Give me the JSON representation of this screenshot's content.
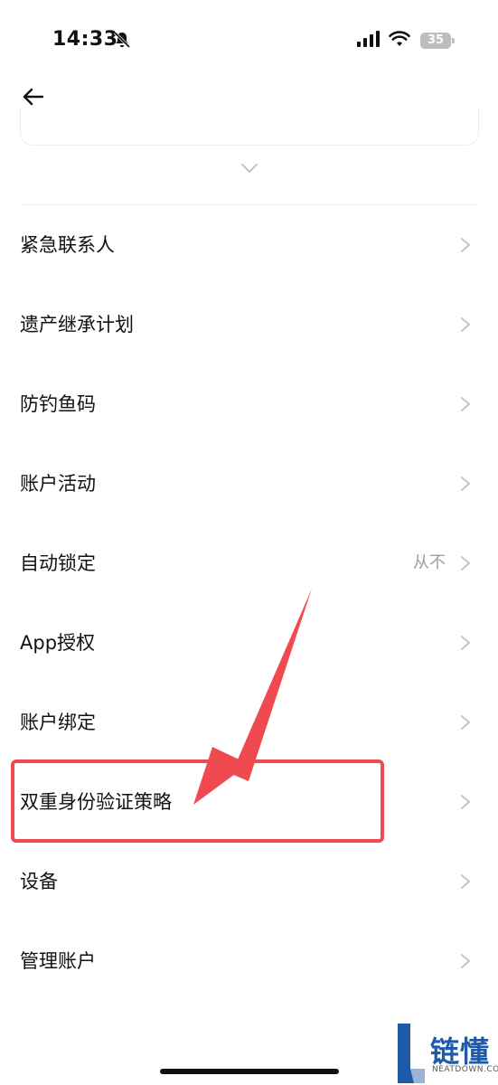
{
  "status_bar": {
    "time": "14:33",
    "battery": "35"
  },
  "menu_items": [
    {
      "label": "紧急联系人",
      "value": ""
    },
    {
      "label": "遗产继承计划",
      "value": ""
    },
    {
      "label": "防钓鱼码",
      "value": ""
    },
    {
      "label": "账户活动",
      "value": ""
    },
    {
      "label": "自动锁定",
      "value": "从不"
    },
    {
      "label": "App授权",
      "value": ""
    },
    {
      "label": "账户绑定",
      "value": ""
    },
    {
      "label": "双重身份验证策略",
      "value": ""
    },
    {
      "label": "设备",
      "value": ""
    },
    {
      "label": "管理账户",
      "value": ""
    }
  ],
  "watermark": {
    "title": "链懂",
    "subtitle": "NEATDOWN.COM"
  },
  "colors": {
    "highlight": "#ef4a50",
    "chevron": "#c4c4c4",
    "value_text": "#9e9e9e"
  }
}
